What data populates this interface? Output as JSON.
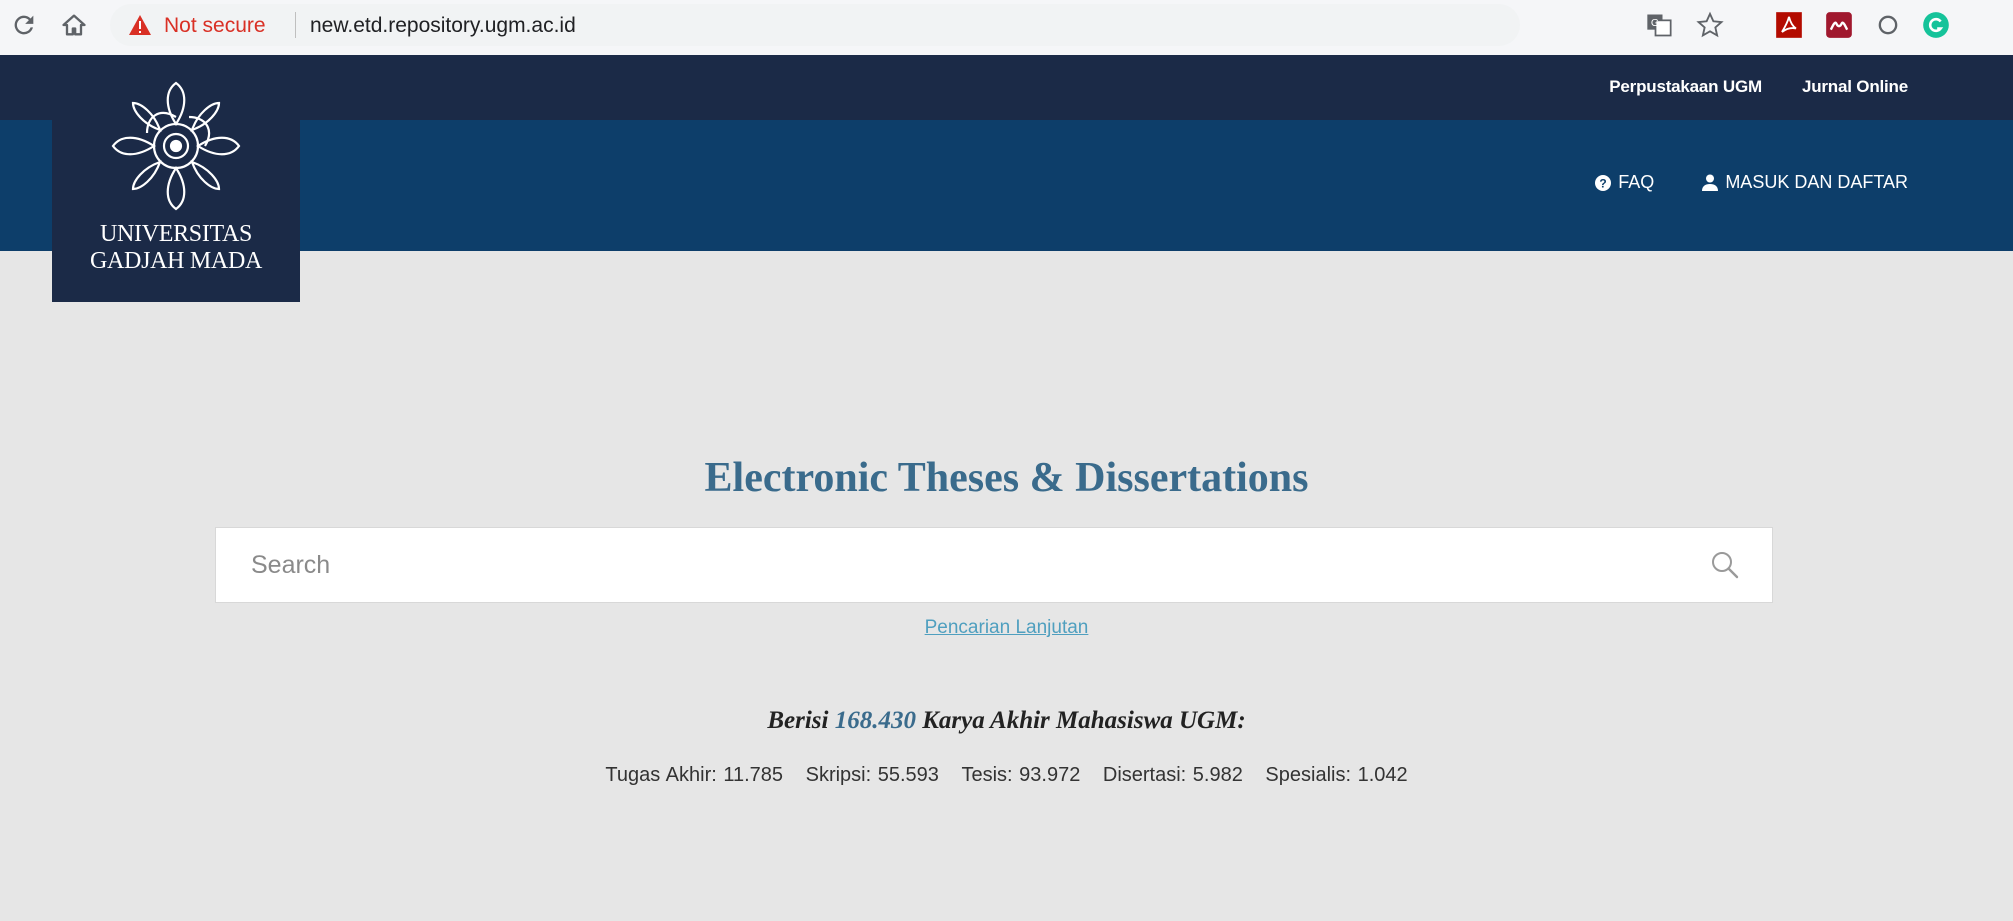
{
  "browser": {
    "security_label": "Not secure",
    "url": "new.etd.repository.ugm.ac.id"
  },
  "icons": {
    "reload": "reload-icon",
    "home": "home-icon",
    "warning": "warning-icon",
    "translate": "translate-icon",
    "star": "star-icon",
    "pdf": "pdf-extension-icon",
    "mendeley": "mendeley-extension-icon",
    "circle": "circle-extension-icon",
    "grammarly": "grammarly-extension-icon",
    "faq": "question-circle-icon",
    "user": "user-icon",
    "search": "search-icon"
  },
  "colors": {
    "topbar": "#1b2a47",
    "header": "#0d3e6a",
    "title": "#3a6b8c",
    "link": "#4f9fbf",
    "background": "#e6e6e6"
  },
  "logo": {
    "line1": "UNIVERSITAS",
    "line2": "GADJAH MADA"
  },
  "topbar": {
    "links": [
      "Perpustakaan UGM",
      "Jurnal Online"
    ]
  },
  "nav": {
    "faq": "FAQ",
    "login": "MASUK DAN DAFTAR"
  },
  "main": {
    "title": "Electronic Theses & Dissertations",
    "search_placeholder": "Search",
    "advanced_search": "Pencarian Lanjutan",
    "summary_prefix": "Berisi",
    "summary_count": "168.430",
    "summary_suffix": "Karya Akhir Mahasiswa UGM:",
    "stats": [
      "Tugas Akhir: 11.785",
      "Skripsi: 55.593",
      "Tesis: 93.972",
      "Disertasi: 5.982",
      "Spesialis: 1.042"
    ]
  }
}
